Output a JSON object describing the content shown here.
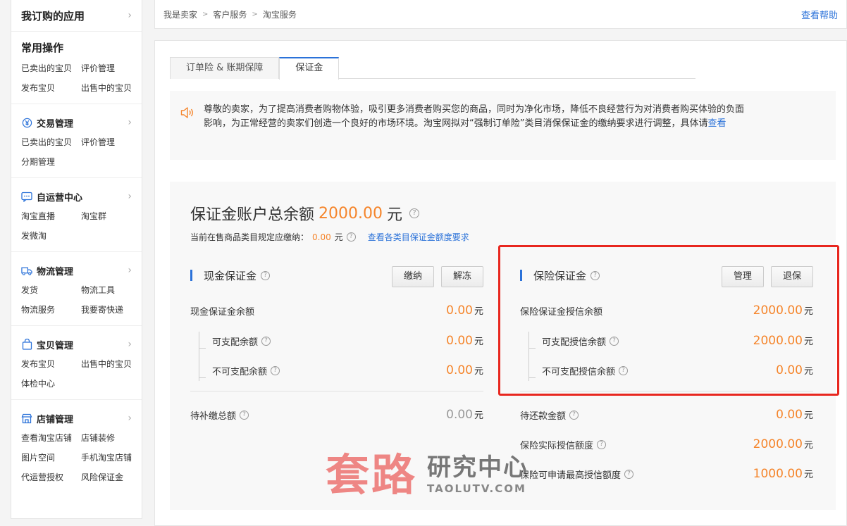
{
  "sidebar": {
    "top": "我订购的应用",
    "common": {
      "title": "常用操作",
      "items": [
        "已卖出的宝贝",
        "评价管理",
        "发布宝贝",
        "出售中的宝贝"
      ]
    },
    "sections": [
      {
        "title": "交易管理",
        "icon": "yen-icon",
        "items": [
          "已卖出的宝贝",
          "评价管理",
          "分期管理"
        ]
      },
      {
        "title": "自运营中心",
        "icon": "chat-icon",
        "items": [
          "淘宝直播",
          "淘宝群",
          "发微淘"
        ]
      },
      {
        "title": "物流管理",
        "icon": "truck-icon",
        "items": [
          "发货",
          "物流工具",
          "物流服务",
          "我要寄快递"
        ]
      },
      {
        "title": "宝贝管理",
        "icon": "bag-icon",
        "items": [
          "发布宝贝",
          "出售中的宝贝",
          "体检中心"
        ]
      },
      {
        "title": "店铺管理",
        "icon": "shop-icon",
        "items": [
          "查看淘宝店铺",
          "店铺装修",
          "图片空间",
          "手机淘宝店铺",
          "代运营授权",
          "风险保证金"
        ]
      }
    ]
  },
  "breadcrumb": {
    "items": [
      "我是卖家",
      "客户服务",
      "淘宝服务"
    ],
    "sep": ">",
    "help": "查看帮助"
  },
  "tabs": [
    "订单险 & 账期保障",
    "保证金"
  ],
  "notice": {
    "text": "尊敬的卖家，为了提高消费者购物体验，吸引更多消费者购买您的商品，同时为净化市场，降低不良经营行为对消费者购买体验的负面影响，为正常经营的卖家们创造一个良好的市场环境。淘宝网拟对“强制订单险”类目消保保证金的缴纳要求进行调整，具体请",
    "link": "查看"
  },
  "account": {
    "title": "保证金账户总余额",
    "amount": "2000.00",
    "unit": "元",
    "sub_label": "当前在售商品类目规定应缴纳：",
    "sub_amount": "0.00",
    "sub_unit": "元",
    "sub_link": "查看各类目保证金额度要求"
  },
  "cash": {
    "title": "现金保证金",
    "buttons": [
      "缴纳",
      "解冻"
    ],
    "balance_label": "现金保证金余额",
    "balance": "0.00",
    "avail_label": "可支配余额",
    "avail": "0.00",
    "unavail_label": "不可支配余额",
    "unavail": "0.00",
    "pending_label": "待补缴总额",
    "pending": "0.00",
    "unit": "元"
  },
  "insurance": {
    "title": "保险保证金",
    "buttons": [
      "管理",
      "退保"
    ],
    "credit_label": "保险保证金授信余额",
    "credit": "2000.00",
    "avail_label": "可支配授信余额",
    "avail": "2000.00",
    "unavail_label": "不可支配授信余额",
    "unavail": "0.00",
    "repay_label": "待还款金额",
    "repay": "0.00",
    "actual_label": "保险实际授信额度",
    "actual": "2000.00",
    "max_label": "保险可申请最高授信额度",
    "max": "1000.00",
    "unit": "元"
  },
  "watermark": {
    "big": "套路",
    "cn": "研究中心",
    "en": "TAOLUTV.COM"
  },
  "colors": {
    "accent": "#2b72d9",
    "amount": "#f5852b",
    "highlight_box": "#e8271f"
  }
}
